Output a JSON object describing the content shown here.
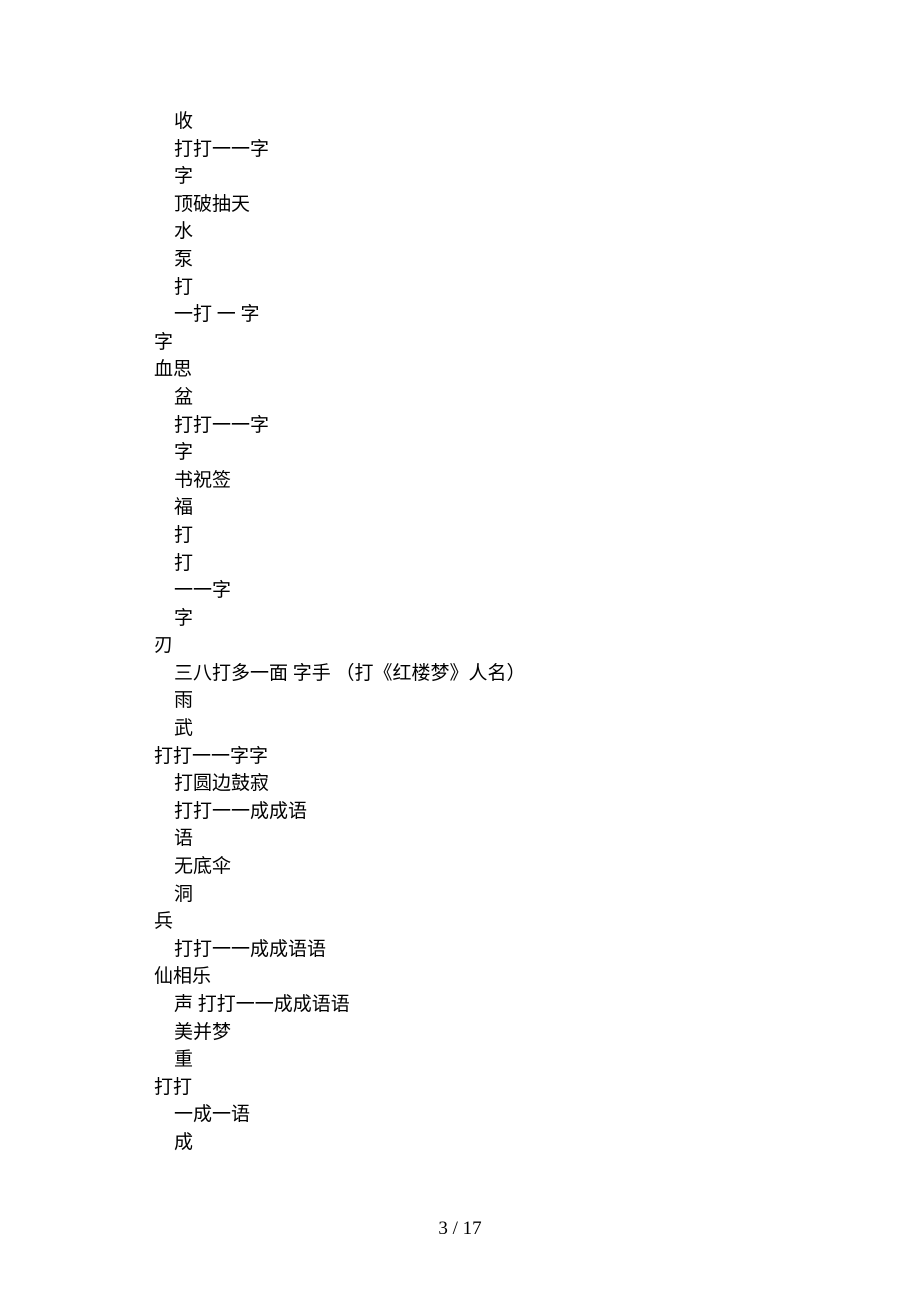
{
  "lines": [
    {
      "text": "收",
      "indent": 1
    },
    {
      "text": "打打一一字",
      "indent": 1
    },
    {
      "text": "字",
      "indent": 1
    },
    {
      "text": "顶破抽天",
      "indent": 1
    },
    {
      "text": "水",
      "indent": 1
    },
    {
      "text": "泵",
      "indent": 1
    },
    {
      "text": "打",
      "indent": 1
    },
    {
      "text": "一打 一 字",
      "indent": 1
    },
    {
      "text": "字",
      "indent": 0
    },
    {
      "text": "血思",
      "indent": 0
    },
    {
      "text": "盆",
      "indent": 1
    },
    {
      "text": "打打一一字",
      "indent": 1
    },
    {
      "text": "字",
      "indent": 1
    },
    {
      "text": "书祝签",
      "indent": 1
    },
    {
      "text": "福",
      "indent": 1
    },
    {
      "text": "打",
      "indent": 1
    },
    {
      "text": "打",
      "indent": 1
    },
    {
      "text": "一一字",
      "indent": 1
    },
    {
      "text": "字",
      "indent": 1
    },
    {
      "text": "刃",
      "indent": 0
    },
    {
      "text": "三八打多一面 字手 （打《红楼梦》人名）",
      "indent": 1
    },
    {
      "text": "雨",
      "indent": 1
    },
    {
      "text": "武",
      "indent": 1
    },
    {
      "text": "打打一一字字",
      "indent": 0
    },
    {
      "text": "打圆边鼓寂",
      "indent": 1
    },
    {
      "text": "打打一一成成语",
      "indent": 1
    },
    {
      "text": "语",
      "indent": 1
    },
    {
      "text": "无底伞",
      "indent": 1
    },
    {
      "text": "洞",
      "indent": 1
    },
    {
      "text": "兵",
      "indent": 0
    },
    {
      "text": "打打一一成成语语",
      "indent": 1
    },
    {
      "text": "仙相乐",
      "indent": 0
    },
    {
      "text": "声 打打一一成成语语",
      "indent": 1
    },
    {
      "text": "美并梦",
      "indent": 1
    },
    {
      "text": "重",
      "indent": 1
    },
    {
      "text": "打打",
      "indent": 0
    },
    {
      "text": "一成一语",
      "indent": 1
    },
    {
      "text": "成",
      "indent": 1
    }
  ],
  "pageNumber": "3 / 17"
}
